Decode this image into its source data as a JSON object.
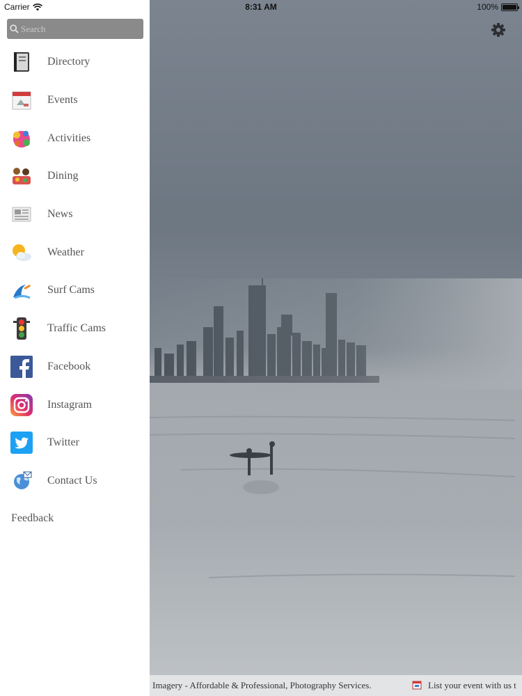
{
  "status_bar": {
    "carrier": "Carrier",
    "time": "8:31 AM",
    "battery": "100%",
    "battery_level": 1.0
  },
  "search": {
    "placeholder": "Search"
  },
  "menu": {
    "items": [
      {
        "label": "Directory",
        "icon": "directory-book-icon"
      },
      {
        "label": "Events",
        "icon": "events-calendar-icon"
      },
      {
        "label": "Activities",
        "icon": "activities-icon"
      },
      {
        "label": "Dining",
        "icon": "dining-icon"
      },
      {
        "label": "News",
        "icon": "newspaper-icon"
      },
      {
        "label": "Weather",
        "icon": "weather-sun-cloud-icon"
      },
      {
        "label": "Surf Cams",
        "icon": "surf-cams-icon"
      },
      {
        "label": "Traffic Cams",
        "icon": "traffic-light-icon"
      },
      {
        "label": "Facebook",
        "icon": "facebook-icon"
      },
      {
        "label": "Instagram",
        "icon": "instagram-icon"
      },
      {
        "label": "Twitter",
        "icon": "twitter-icon"
      },
      {
        "label": "Contact Us",
        "icon": "contact-globe-icon"
      }
    ],
    "feedback": "Feedback"
  },
  "ticker": {
    "text_1": "Imagery - Affordable & Professional, Photography Services.",
    "text_2": "List your event with us t"
  },
  "colors": {
    "drawer_bg": "#ffffff",
    "search_bg": "#8a8a8a",
    "label_text": "#555555",
    "overlay": "#7d8590",
    "facebook": "#3b5998",
    "twitter": "#1da1f2"
  }
}
